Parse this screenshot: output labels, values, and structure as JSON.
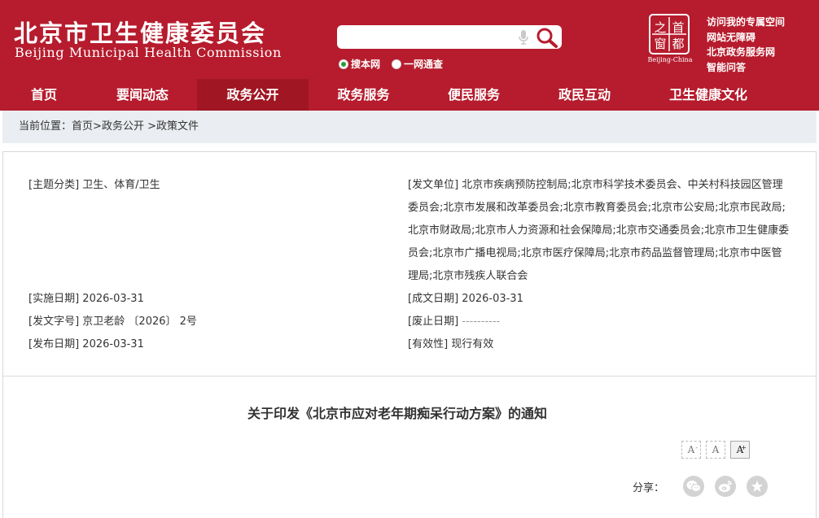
{
  "header": {
    "logo_cn": "北京市卫生健康委员会",
    "logo_en": "Beijing Municipal Health Commission",
    "search": {
      "value": "",
      "placeholder": ""
    },
    "radios": [
      {
        "label": "搜本网",
        "checked": true
      },
      {
        "label": "一网通查",
        "checked": false
      }
    ],
    "seal": {
      "chars": [
        "之",
        "首",
        "窗",
        "都"
      ],
      "caption": "Beijing-China"
    },
    "quick_links": [
      "访问我的专属空间",
      "网站无障碍",
      "北京政务服务网",
      "智能问答"
    ]
  },
  "nav": {
    "items": [
      "首页",
      "要闻动态",
      "政务公开",
      "政务服务",
      "便民服务",
      "政民互动",
      "卫生健康文化"
    ],
    "active_index": 2
  },
  "breadcrumb": {
    "prefix": "当前位置：",
    "items": [
      "首页",
      "政务公开",
      "政策文件"
    ]
  },
  "meta": {
    "subject_label": "[主题分类]",
    "subject_value": "卫生、体育/卫生",
    "issuer_label": "[发文单位]",
    "issuer_value": "北京市疾病预防控制局;北京市科学技术委员会、中关村科技园区管理委员会;北京市发展和改革委员会;北京市教育委员会;北京市公安局;北京市民政局;北京市财政局;北京市人力资源和社会保障局;北京市交通委员会;北京市卫生健康委员会;北京市广播电视局;北京市医疗保障局;北京市药品监督管理局;北京市中医管理局;北京市残疾人联合会",
    "effective_label": "[实施日期]",
    "effective_value": "2026-03-31",
    "written_label": "[成文日期]",
    "written_value": "2026-03-31",
    "docno_label": "[发文字号]",
    "docno_value": "京卫老龄 〔2026〕 2号",
    "abolish_label": "[废止日期]",
    "abolish_value": "----------",
    "publish_label": "[发布日期]",
    "publish_value": "2026-03-31",
    "validity_label": "[有效性]",
    "validity_value": "现行有效"
  },
  "document": {
    "title": "关于印发《北京市应对老年期痴呆行动方案》的通知"
  },
  "font_size": {
    "small": "A",
    "medium": "A",
    "large": "A",
    "small_sup": "-",
    "large_sup": "+"
  },
  "share": {
    "label": "分享：",
    "icons": [
      "wechat-icon",
      "weibo-icon",
      "favorite-icon"
    ]
  },
  "colors": {
    "brand": "#b61c2d",
    "nav_active": "#a01623",
    "breadcrumb_bg": "#eaedf1",
    "radio_checked": "#2b9b3a"
  }
}
